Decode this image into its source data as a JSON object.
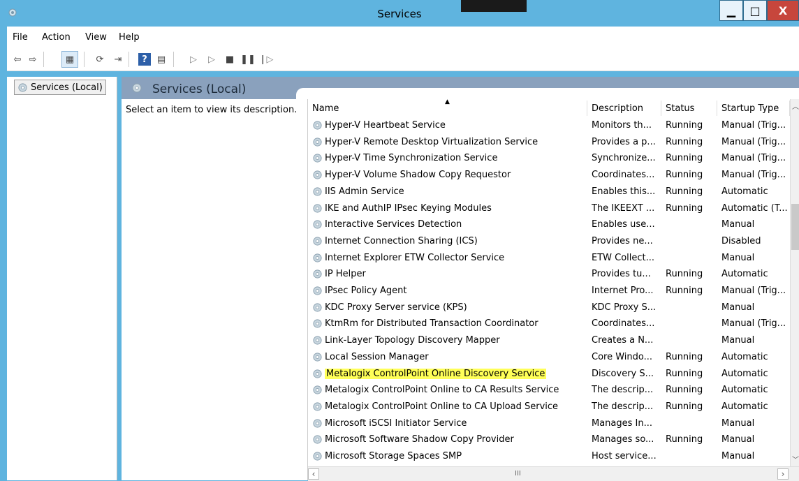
{
  "window": {
    "title": "Services"
  },
  "menu": [
    "File",
    "Action",
    "View",
    "Help"
  ],
  "tree": {
    "root_label": "Services (Local)"
  },
  "pane": {
    "header": "Services (Local)",
    "description_prompt": "Select an item to view its description."
  },
  "columns": [
    "Name",
    "Description",
    "Status",
    "Startup Type"
  ],
  "rows": [
    {
      "name": "Hyper-V Heartbeat Service",
      "description": "Monitors th...",
      "status": "Running",
      "startup": "Manual (Trig..."
    },
    {
      "name": "Hyper-V Remote Desktop Virtualization Service",
      "description": "Provides a p...",
      "status": "Running",
      "startup": "Manual (Trig..."
    },
    {
      "name": "Hyper-V Time Synchronization Service",
      "description": "Synchronize...",
      "status": "Running",
      "startup": "Manual (Trig..."
    },
    {
      "name": "Hyper-V Volume Shadow Copy Requestor",
      "description": "Coordinates...",
      "status": "Running",
      "startup": "Manual (Trig..."
    },
    {
      "name": "IIS Admin Service",
      "description": "Enables this...",
      "status": "Running",
      "startup": "Automatic"
    },
    {
      "name": "IKE and AuthIP IPsec Keying Modules",
      "description": "The IKEEXT ...",
      "status": "Running",
      "startup": "Automatic (T..."
    },
    {
      "name": "Interactive Services Detection",
      "description": "Enables use...",
      "status": "",
      "startup": "Manual"
    },
    {
      "name": "Internet Connection Sharing (ICS)",
      "description": "Provides ne...",
      "status": "",
      "startup": "Disabled"
    },
    {
      "name": "Internet Explorer ETW Collector Service",
      "description": "ETW Collect...",
      "status": "",
      "startup": "Manual"
    },
    {
      "name": "IP Helper",
      "description": "Provides tu...",
      "status": "Running",
      "startup": "Automatic"
    },
    {
      "name": "IPsec Policy Agent",
      "description": "Internet Pro...",
      "status": "Running",
      "startup": "Manual (Trig..."
    },
    {
      "name": "KDC Proxy Server service (KPS)",
      "description": "KDC Proxy S...",
      "status": "",
      "startup": "Manual"
    },
    {
      "name": "KtmRm for Distributed Transaction Coordinator",
      "description": "Coordinates...",
      "status": "",
      "startup": "Manual (Trig..."
    },
    {
      "name": "Link-Layer Topology Discovery Mapper",
      "description": "Creates a N...",
      "status": "",
      "startup": "Manual"
    },
    {
      "name": "Local Session Manager",
      "description": "Core Windo...",
      "status": "Running",
      "startup": "Automatic"
    },
    {
      "name": "Metalogix ControlPoint Online Discovery Service",
      "description": "Discovery S...",
      "status": "Running",
      "startup": "Automatic",
      "highlighted": true
    },
    {
      "name": "Metalogix ControlPoint Online to CA Results Service",
      "description": "The descrip...",
      "status": "Running",
      "startup": "Automatic"
    },
    {
      "name": "Metalogix ControlPoint Online to CA Upload Service",
      "description": "The descrip...",
      "status": "Running",
      "startup": "Automatic"
    },
    {
      "name": "Microsoft iSCSI Initiator Service",
      "description": "Manages In...",
      "status": "",
      "startup": "Manual"
    },
    {
      "name": "Microsoft Software Shadow Copy Provider",
      "description": "Manages so...",
      "status": "Running",
      "startup": "Manual"
    },
    {
      "name": "Microsoft Storage Spaces SMP",
      "description": "Host service...",
      "status": "",
      "startup": "Manual"
    }
  ],
  "highlight_color": "#ffff58"
}
